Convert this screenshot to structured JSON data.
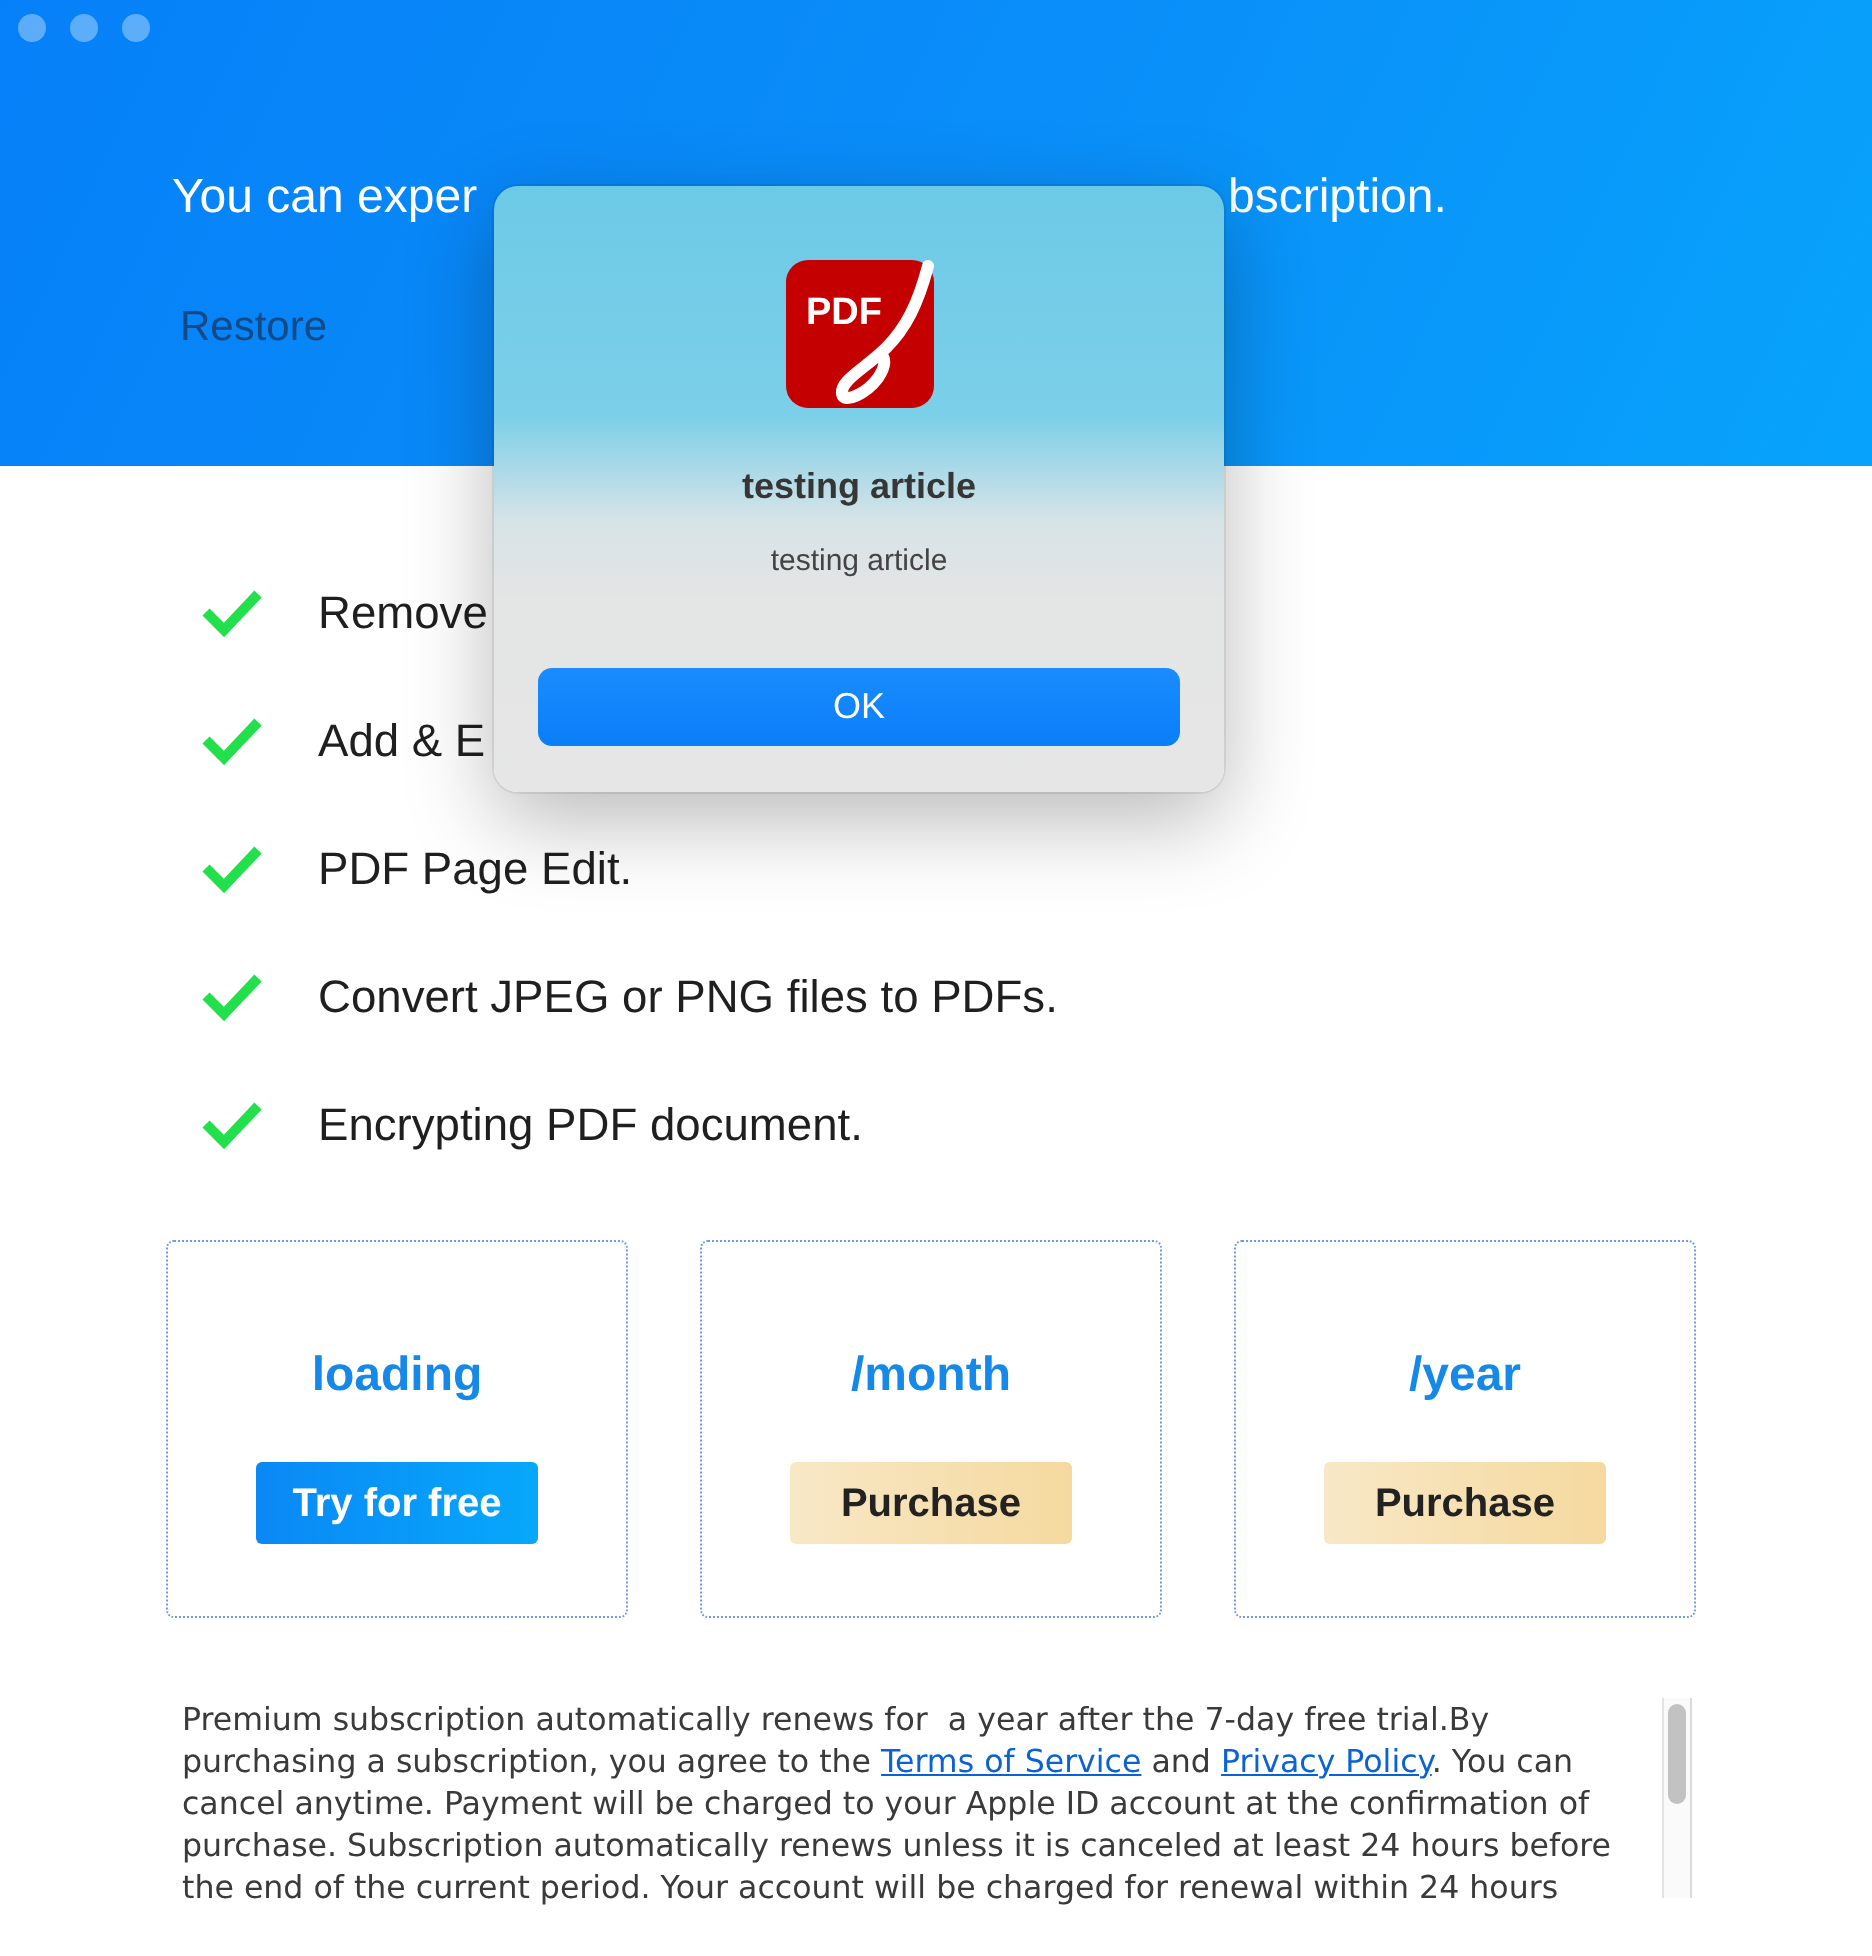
{
  "window": {
    "active": false
  },
  "header": {
    "headline": {
      "left": "You can exper",
      "right": "bscription."
    },
    "restore": "Restore"
  },
  "dialog": {
    "logo_text": "PDF",
    "title": "testing article",
    "message": "testing article",
    "button": "OK"
  },
  "features": [
    "Remove",
    "Add & E",
    "PDF Page Edit.",
    "Convert JPEG or PNG files to PDFs.",
    "Encrypting PDF document."
  ],
  "plans": [
    {
      "title": "loading",
      "button": {
        "label": "Try for free",
        "kind": "trial"
      }
    },
    {
      "title": "/month",
      "button": {
        "label": "Purchase",
        "kind": "purchase"
      }
    },
    {
      "title": "/year",
      "button": {
        "label": "Purchase",
        "kind": "purchase"
      }
    }
  ],
  "terms": {
    "parts": [
      {
        "kind": "text",
        "text": "Premium subscription automatically renews for  a year after the 7-day free trial.By purchasing a subscription, you agree to the "
      },
      {
        "kind": "link",
        "text": "Terms of Service"
      },
      {
        "kind": "text",
        "text": " and "
      },
      {
        "kind": "link",
        "text": "Privacy Policy"
      },
      {
        "kind": "text",
        "text": ". You can cancel anytime. Payment will be charged to your Apple ID account at the confirmation of purchase. Subscription automatically renews unless it is canceled at least 24 hours before the end of the current period. Your account will be charged for renewal within 24 hours"
      }
    ]
  }
}
